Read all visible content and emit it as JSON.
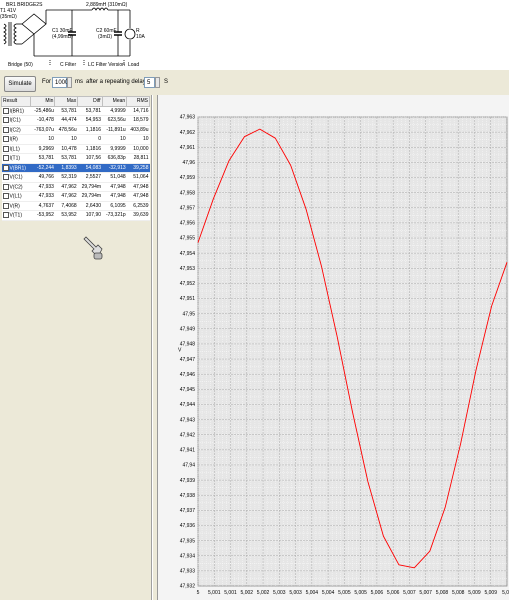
{
  "schematic": {
    "part_name": "BR1 BRIDGE2S",
    "transformer": {
      "label1": "T1 41V",
      "label2": "(35mΩ)"
    },
    "inductor": {
      "label": "2,889mH (310mΩ)"
    },
    "c1": {
      "label1": "C1 30mF",
      "label2": "(4,99mΩ)"
    },
    "c2": {
      "label1": "C2 60mF",
      "label2": "(3mΩ)"
    },
    "load": {
      "label1": "R",
      "label2": "10A"
    },
    "captions": [
      "Bridge (50)",
      "C Filter",
      "LC Filter Version",
      "Load"
    ]
  },
  "toolbar": {
    "simulate_label": "Simulate",
    "for_label": "For",
    "duration_value": "1000",
    "ms_label": "ms",
    "delay_text": "after a repeating delay of",
    "delay_value": "5",
    "s_label": "S"
  },
  "results": {
    "columns": [
      "Result",
      "Min",
      "Max",
      "Diff",
      "Mean",
      "RMS"
    ],
    "selected_index": 6,
    "rows": [
      [
        "I(BR1)",
        "-25,486u",
        "53,781",
        "53,781",
        "4,9999",
        "14,716"
      ],
      [
        "I(C1)",
        "-10,478",
        "44,474",
        "54,953",
        "623,56u",
        "18,579"
      ],
      [
        "I(C2)",
        "-763,07u",
        "478,56u",
        "1,1816",
        "-11,891u",
        "403,89u"
      ],
      [
        "I(R)",
        "10",
        "10",
        "0",
        "10",
        "10"
      ],
      [
        "I(L1)",
        "9,2969",
        "10,478",
        "1,1816",
        "9,9999",
        "10,000"
      ],
      [
        "I(T1)",
        "53,781",
        "53,781",
        "107,56",
        "636,83p",
        "28,811"
      ],
      [
        "V(BR1)",
        "-52,244",
        "1,8393",
        "54,083",
        "-32,913",
        "39,258"
      ],
      [
        "V(C1)",
        "49,766",
        "52,319",
        "2,5527",
        "51,048",
        "51,064"
      ],
      [
        "V(C2)",
        "47,933",
        "47,962",
        "29,794m",
        "47,948",
        "47,948"
      ],
      [
        "V(L1)",
        "47,933",
        "47,962",
        "29,794m",
        "47,948",
        "47,948"
      ],
      [
        "V(R)",
        "4,7637",
        "7,4068",
        "2,6430",
        "6,1095",
        "6,2539"
      ],
      [
        "V(T1)",
        "-53,952",
        "53,952",
        "107,90",
        "-73,321p",
        "39,639"
      ]
    ]
  },
  "graph": {
    "trace_color": "#ff0000",
    "ylabel": "V",
    "y_ticks": [
      "47,963",
      "47,962",
      "47,961",
      "47,96",
      "47,959",
      "47,958",
      "47,957",
      "47,956",
      "47,955",
      "47,954",
      "47,953",
      "47,952",
      "47,951",
      "47,95",
      "47,949",
      "47,948",
      "47,947",
      "47,946",
      "47,945",
      "47,944",
      "47,943",
      "47,942",
      "47,941",
      "47,94",
      "47,939",
      "47,938",
      "47,937",
      "47,936",
      "47,935",
      "47,934",
      "47,933",
      "47,932"
    ],
    "x_ticks": [
      "5",
      "5,001",
      "5,001",
      "5,002",
      "5,002",
      "5,003",
      "5,003",
      "5,004",
      "5,004",
      "5,005",
      "5,005",
      "5,006",
      "5,006",
      "5,007",
      "5,007",
      "5,008",
      "5,008",
      "5,009",
      "5,009",
      "5,01"
    ]
  },
  "chart_data": {
    "type": "line",
    "ylabel": "V",
    "ylim": [
      47.932,
      47.963
    ],
    "xlim": [
      5.0,
      5.01
    ],
    "grid": true,
    "series": [
      {
        "x": [
          5.0,
          5.0005,
          5.001,
          5.0015,
          5.002,
          5.0025,
          5.003,
          5.0035,
          5.004,
          5.0045,
          5.005,
          5.0055,
          5.006,
          5.0065,
          5.007,
          5.0075,
          5.008,
          5.0085,
          5.009,
          5.0095,
          5.01
        ],
        "y": [
          47.9547,
          47.9576,
          47.9601,
          47.9617,
          47.9622,
          47.9616,
          47.9598,
          47.9569,
          47.9531,
          47.9485,
          47.9435,
          47.9389,
          47.9353,
          47.9334,
          47.9332,
          47.9343,
          47.9372,
          47.9414,
          47.9463,
          47.9505,
          47.9534
        ]
      }
    ]
  }
}
